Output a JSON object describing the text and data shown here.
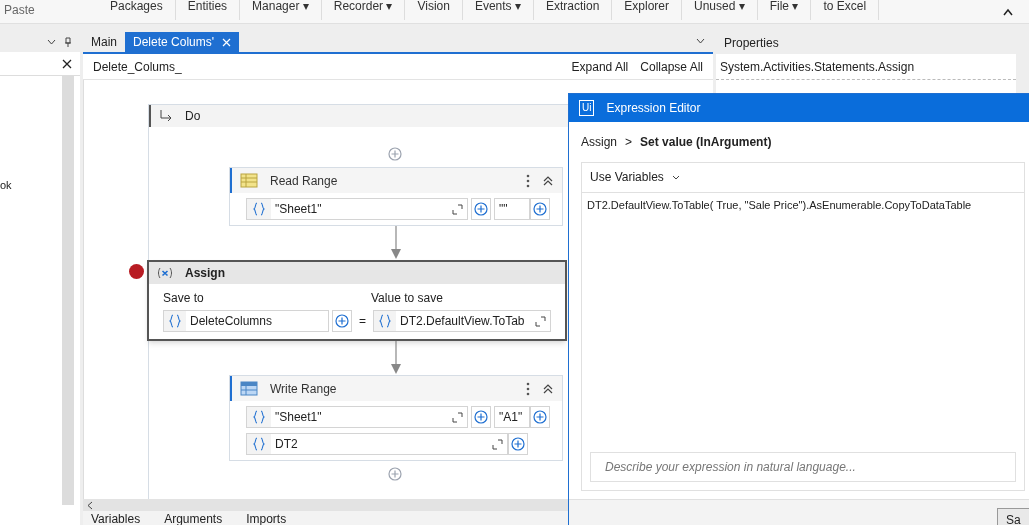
{
  "ribbon": {
    "items": [
      "Paste",
      "Packages",
      "Entities",
      "Manager ▾",
      "Recorder ▾",
      "Vision",
      "Events ▾",
      "Extraction",
      "Explorer",
      "Unused ▾",
      "File ▾",
      "to Excel"
    ]
  },
  "left_panel": {
    "text_fragment": "ok"
  },
  "tabs": [
    {
      "label": "Main",
      "selected": false
    },
    {
      "label": "Delete Colums'",
      "selected": true
    }
  ],
  "designer": {
    "breadcrumb": "Delete_Colums_",
    "expand_all": "Expand All",
    "collapse_all": "Collapse All",
    "sequence_label": "Do",
    "activities": [
      {
        "kind": "read_range",
        "title": "Read Range",
        "rows": [
          [
            {
              "kind": "long",
              "value": "\"Sheet1\""
            },
            {
              "kind": "short",
              "value": "\"\""
            }
          ]
        ]
      },
      {
        "kind": "assign",
        "title": "Assign",
        "breakpoint": true,
        "save_to_label": "Save to",
        "value_label": "Value to save",
        "save_to": "DeleteColumns",
        "equals": "=",
        "value": "DT2.DefaultView.ToTab"
      },
      {
        "kind": "write_range",
        "title": "Write Range",
        "rows": [
          [
            {
              "kind": "long",
              "value": "\"Sheet1\""
            },
            {
              "kind": "short",
              "value": "\"A1\""
            }
          ],
          [
            {
              "kind": "full",
              "value": "DT2"
            }
          ]
        ]
      }
    ]
  },
  "bottom_tabs": [
    "Variables",
    "Arguments",
    "Imports"
  ],
  "properties": {
    "title": "Properties",
    "type_name": "System.Activities.Statements.Assign"
  },
  "dialog": {
    "logo": "Ui",
    "title": "Expression Editor",
    "crumb_parent": "Assign",
    "crumb_separator": ">",
    "crumb_child": "Set value (InArgument)",
    "use_variables": "Use Variables",
    "expression": "DT2.DefaultView.ToTable( True, \"Sale Price\").AsEnumerable.CopyToDataTable",
    "placeholder": "Describe your expression in natural language...",
    "save_button": "Sa"
  }
}
